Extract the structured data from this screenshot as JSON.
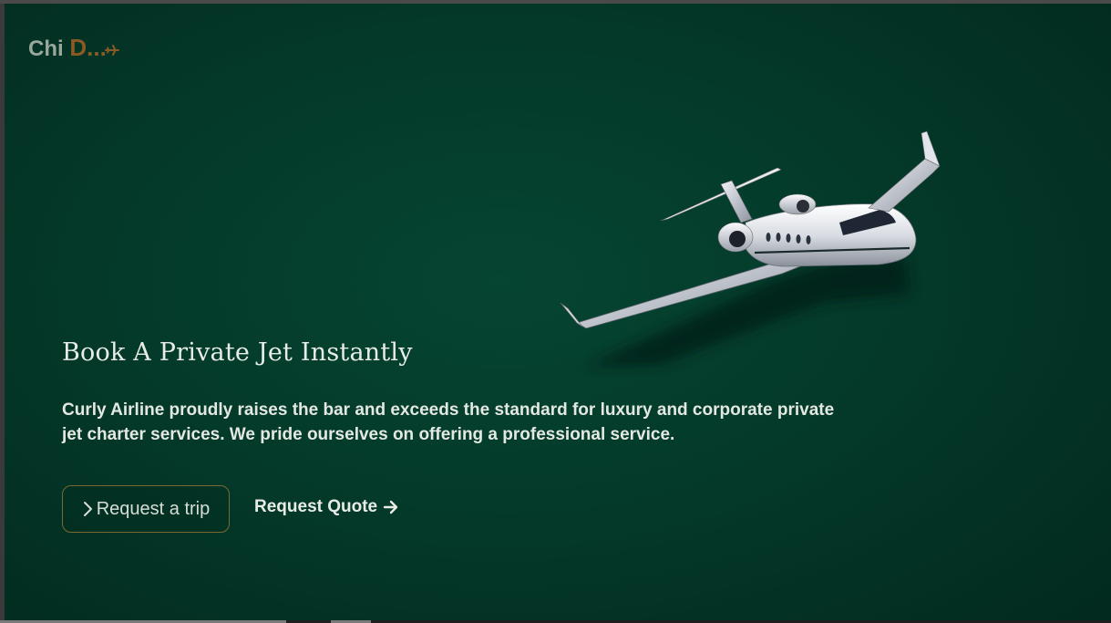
{
  "brand": {
    "name_part1": "Chi",
    "name_part2": "D...",
    "primary_color": "#9aa79c",
    "accent_color": "#8a5a24",
    "icon": "plane-icon"
  },
  "hero": {
    "title": "Book A Private Jet Instantly",
    "description": "Curly Airline proudly raises the bar and exceeds the standard for luxury and corporate private jet charter services. We pride ourselves on offering a professional service.",
    "image": "private-jet-image",
    "background_color": "#043a2a"
  },
  "actions": {
    "request_trip_label": "Request a trip",
    "request_trip_icon": "chevron-right-icon",
    "request_quote_label": "Request Quote",
    "request_quote_icon": "arrow-right-icon"
  }
}
